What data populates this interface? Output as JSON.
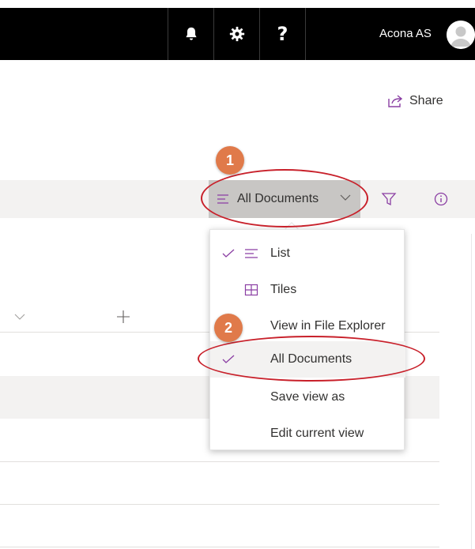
{
  "header": {
    "account_name": "Acona AS",
    "icons": [
      "bell-icon",
      "gear-icon",
      "help-icon",
      "avatar-icon"
    ],
    "help_glyph": "?"
  },
  "toolbar": {
    "share_label": "Share"
  },
  "commandbar": {
    "view_label": "All Documents"
  },
  "view_menu": {
    "items": [
      {
        "label": "List",
        "checked": true,
        "icon": "list-icon"
      },
      {
        "label": "Tiles",
        "checked": false,
        "icon": "tiles-icon"
      },
      {
        "label": "View in File Explorer",
        "checked": false
      },
      {
        "label": "All Documents",
        "checked": true
      },
      {
        "label": "Save view as",
        "checked": false
      },
      {
        "label": "Edit current view",
        "checked": false
      }
    ]
  },
  "annotations": {
    "step1": "1",
    "step2": "2"
  },
  "colors": {
    "accent": "#8a3ea3",
    "callout": "#e07a4a",
    "ellipse": "#c8202a",
    "topbar": "#000000"
  }
}
